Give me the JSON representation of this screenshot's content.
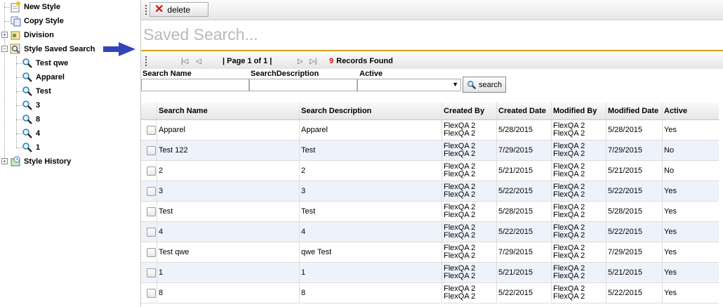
{
  "tree": {
    "items": [
      {
        "label": "New Style",
        "icon": "new-style-icon"
      },
      {
        "label": "Copy Style",
        "icon": "copy-style-icon"
      },
      {
        "label": "Division",
        "icon": "division-icon",
        "expander": "+"
      },
      {
        "label": "Style Saved Search",
        "icon": "saved-search-icon",
        "expander": "-"
      },
      {
        "label": "Test qwe",
        "icon": "magnifier-icon"
      },
      {
        "label": "Apparel",
        "icon": "magnifier-icon"
      },
      {
        "label": "Test",
        "icon": "magnifier-icon"
      },
      {
        "label": "3",
        "icon": "magnifier-icon"
      },
      {
        "label": "8",
        "icon": "magnifier-icon"
      },
      {
        "label": "4",
        "icon": "magnifier-icon"
      },
      {
        "label": "1",
        "icon": "magnifier-icon"
      },
      {
        "label": "Style History",
        "icon": "style-history-icon",
        "expander": "+"
      }
    ]
  },
  "toolbar": {
    "delete_label": "delete"
  },
  "page_title": "Saved Search...",
  "pager": {
    "page_text": "| Page 1 of 1 |",
    "records_count": "9",
    "records_text": "Records Found"
  },
  "filters": {
    "search_name_label": "Search Name",
    "search_desc_label": "SearchDescription",
    "active_label": "Active",
    "search_button": "search"
  },
  "grid": {
    "columns": [
      "Search Name",
      "Search Description",
      "Created By",
      "Created Date",
      "Modified By",
      "Modified Date",
      "Active"
    ],
    "rows": [
      {
        "name": "Apparel",
        "desc": "Apparel",
        "created_by": [
          "FlexQA 2",
          "FlexQA 2"
        ],
        "created_date": "5/28/2015",
        "modified_by": [
          "FlexQA 2",
          "FlexQA 2"
        ],
        "modified_date": "5/28/2015",
        "active": "Yes"
      },
      {
        "name": "Test 122",
        "desc": "Test",
        "created_by": [
          "FlexQA 2",
          "FlexQA 2"
        ],
        "created_date": "7/29/2015",
        "modified_by": [
          "FlexQA 2",
          "FlexQA 2"
        ],
        "modified_date": "7/29/2015",
        "active": "No"
      },
      {
        "name": "2",
        "desc": "2",
        "created_by": [
          "FlexQA 2",
          "FlexQA 2"
        ],
        "created_date": "5/21/2015",
        "modified_by": [
          "FlexQA 2",
          "FlexQA 2"
        ],
        "modified_date": "5/21/2015",
        "active": "No"
      },
      {
        "name": "3",
        "desc": "3",
        "created_by": [
          "FlexQA 2",
          "FlexQA 2"
        ],
        "created_date": "5/22/2015",
        "modified_by": [
          "FlexQA 2",
          "FlexQA 2"
        ],
        "modified_date": "5/22/2015",
        "active": "Yes"
      },
      {
        "name": "Test",
        "desc": "Test",
        "created_by": [
          "FlexQA 2",
          "FlexQA 2"
        ],
        "created_date": "5/28/2015",
        "modified_by": [
          "FlexQA 2",
          "FlexQA 2"
        ],
        "modified_date": "5/28/2015",
        "active": "Yes"
      },
      {
        "name": "4",
        "desc": "4",
        "created_by": [
          "FlexQA 2",
          "FlexQA 2"
        ],
        "created_date": "5/22/2015",
        "modified_by": [
          "FlexQA 2",
          "FlexQA 2"
        ],
        "modified_date": "5/22/2015",
        "active": "Yes"
      },
      {
        "name": "Test qwe",
        "desc": "qwe Test",
        "created_by": [
          "FlexQA 2",
          "FlexQA 2"
        ],
        "created_date": "7/29/2015",
        "modified_by": [
          "FlexQA 2",
          "FlexQA 2"
        ],
        "modified_date": "7/29/2015",
        "active": "Yes"
      },
      {
        "name": "1",
        "desc": "1",
        "created_by": [
          "FlexQA 2",
          "FlexQA 2"
        ],
        "created_date": "5/21/2015",
        "modified_by": [
          "FlexQA 2",
          "FlexQA 2"
        ],
        "modified_date": "5/21/2015",
        "active": "Yes"
      },
      {
        "name": "8",
        "desc": "8",
        "created_by": [
          "FlexQA 2",
          "FlexQA 2"
        ],
        "created_date": "5/22/2015",
        "modified_by": [
          "FlexQA 2",
          "FlexQA 2"
        ],
        "modified_date": "5/22/2015",
        "active": "Yes"
      }
    ]
  },
  "colors": {
    "accent_rule": "#d4a017",
    "record_count": "#d01010",
    "arrow": "#3344bb"
  }
}
